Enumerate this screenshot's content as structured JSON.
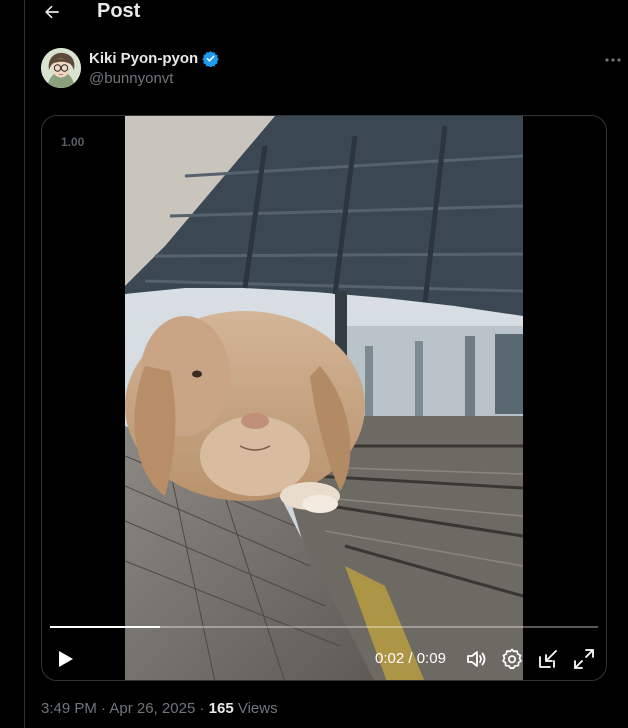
{
  "header": {
    "title": "Post"
  },
  "author": {
    "display_name": "Kiki Pyon-pyon",
    "handle": "@bunnyonvt",
    "verified": true,
    "verified_color": "#1d9bf0"
  },
  "video": {
    "speed_label": "1.00",
    "current_time": "0:02",
    "duration": "0:09",
    "time_separator": " / ",
    "progress_fraction": 0.2
  },
  "post_meta": {
    "time": "3:49 PM",
    "date": "Apr 26, 2025",
    "separator": " · ",
    "views_count": "165",
    "views_label": "Views"
  },
  "icons": {
    "back": "arrow-left-icon",
    "more": "more-horizontal-icon",
    "verified": "verified-badge-icon",
    "play": "play-icon",
    "volume": "volume-icon",
    "settings": "gear-icon",
    "dock": "dock-icon",
    "fullscreen": "fullscreen-icon"
  },
  "colors": {
    "background": "#000000",
    "text_primary": "#e7e9ea",
    "text_secondary": "#71767b",
    "border": "#2f3336"
  }
}
